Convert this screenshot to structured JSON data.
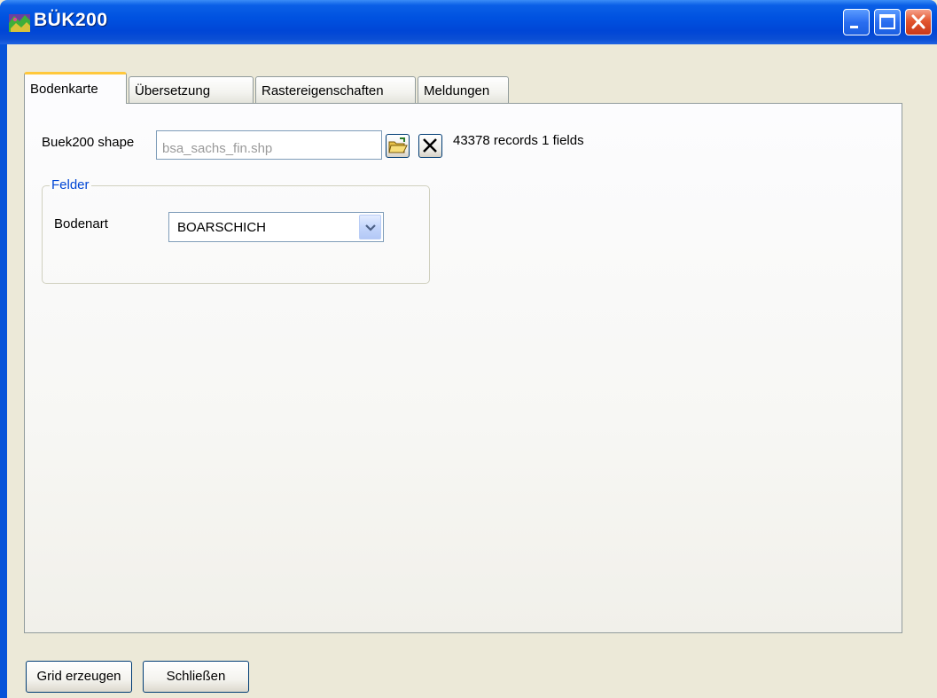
{
  "window": {
    "title": "BÜK200",
    "controls": [
      "minimize-icon",
      "maximize-icon",
      "close-icon"
    ],
    "accent_color": "#0052e0"
  },
  "tabs": [
    {
      "label": "Bodenkarte",
      "active": true
    },
    {
      "label": "Übersetzung",
      "active": false
    },
    {
      "label": "Rastereigenschaften",
      "active": false
    },
    {
      "label": "Meldungen",
      "active": false
    }
  ],
  "shape": {
    "label": "Buek200 shape",
    "value": "bsa_sachs_fin.shp",
    "open_icon": "folder-open-icon",
    "clear_icon": "close-x-icon",
    "info": "43378 records 1 fields"
  },
  "felder": {
    "legend": "Felder",
    "bodenart_label": "Bodenart",
    "bodenart_value": "BOARSCHICH"
  },
  "buttons": {
    "grid": "Grid erzeugen",
    "close": "Schließen"
  }
}
